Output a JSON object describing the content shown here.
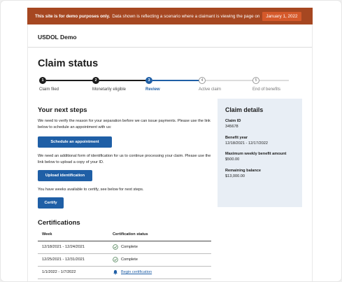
{
  "banner": {
    "bold_text": "This site is for demo purposes only.",
    "text": "Data shown is reflecting a scenario where a claimant is viewing the page on",
    "date": "January 1, 2022"
  },
  "app_name": "USDOL Demo",
  "page_title": "Claim status",
  "steps": [
    {
      "number": "1",
      "label": "Claim filed",
      "state": "complete"
    },
    {
      "number": "2",
      "label": "Monetarily eligible",
      "state": "complete"
    },
    {
      "number": "3",
      "label": "Review",
      "state": "current"
    },
    {
      "number": "4",
      "label": "Active claim",
      "state": "upcoming"
    },
    {
      "number": "5",
      "label": "End of benefits",
      "state": "upcoming"
    }
  ],
  "next_steps": {
    "heading": "Your next steps",
    "text1": "We need to verify the reason for your separation before we can issue payments. Please use the link below to schedule an appointment with us:",
    "button1": "Schedule an appointment",
    "text2": "We need an additional form of identification for us to continue processing your claim. Please use the link below to upload a copy of your ID.",
    "button2": "Upload identification",
    "text3": "You have weeks available to certify, see below for next steps.",
    "button3": "Certify"
  },
  "claim_details": {
    "heading": "Claim details",
    "items": [
      {
        "label": "Claim ID",
        "value": "345678"
      },
      {
        "label": "Benefit year",
        "value": "12/18/2021 - 12/17/2022"
      },
      {
        "label": "Maximum weekly benefit amount",
        "value": "$500.00"
      },
      {
        "label": "Remaining balance",
        "value": "$13,000.00"
      }
    ]
  },
  "certifications": {
    "heading": "Certifications",
    "columns": [
      "Week",
      "Certification status"
    ],
    "rows": [
      {
        "week": "12/18/2021 - 12/24/2021",
        "status": "Complete",
        "kind": "complete"
      },
      {
        "week": "12/25/2021 - 12/31/2021",
        "status": "Complete",
        "kind": "complete"
      },
      {
        "week": "1/1/2022 - 1/7/2022",
        "status": "Begin certification",
        "kind": "action"
      }
    ]
  },
  "colors": {
    "banner": "#a64721",
    "banner_date": "#d5592a",
    "primary": "#1f5fa6",
    "card_bg": "#e8eef5",
    "complete_green": "#4d8055"
  }
}
